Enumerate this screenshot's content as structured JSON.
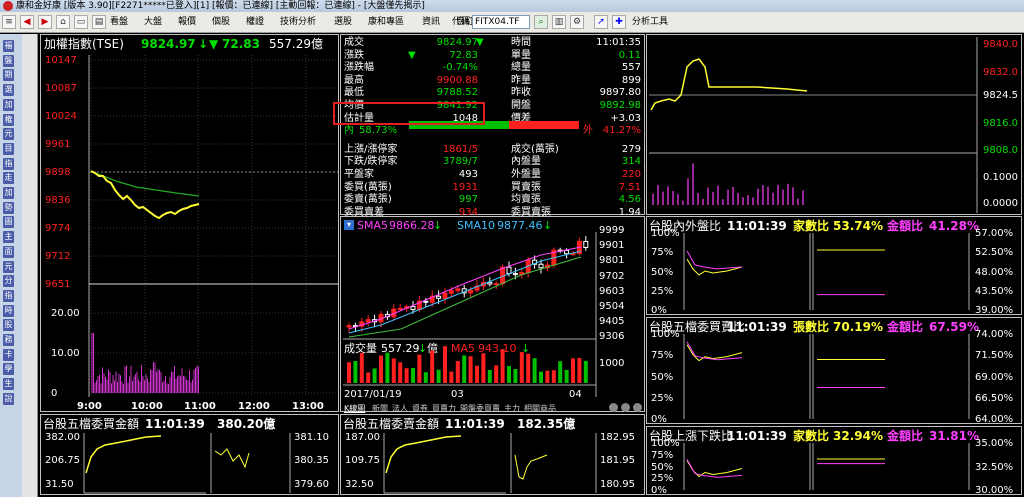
{
  "window": {
    "title": "康和金好康 [版本 3.90][F2271*****已登入][1] [報價：已連線] [主動回報：已連線] - [大盤僅先揭示]"
  },
  "toolbar": {
    "menus": [
      "看盤",
      "大盤",
      "報價",
      "個股",
      "權證",
      "技術分析",
      "選股",
      "康和專區",
      "資訊",
      "自訂",
      "功能"
    ],
    "code_label": "代碼",
    "code_value": "FITX04.TF",
    "analysis_tool": "分析工具"
  },
  "left_menu": [
    "福",
    "盤",
    "期",
    "選",
    "加",
    "権",
    "元",
    "目",
    "指",
    "走",
    "加",
    "勢",
    "圖",
    "主",
    "面",
    "元",
    "分",
    "指",
    "時",
    "股",
    "務",
    "卡",
    "學",
    "生",
    "說"
  ],
  "colors": {
    "up": "#ff2020",
    "down": "#00e000",
    "line_yellow": "#ffff33",
    "line_magenta": "#ff40ff",
    "background": "#000000"
  },
  "index_chart": {
    "title": "加權指數(TSE)",
    "price": "9824.97",
    "arrow": "▼",
    "change": "72.83",
    "volume": "557.29億",
    "y_ticks": [
      "10147",
      "10087",
      "10024",
      "9961",
      "9898",
      "9836",
      "9774",
      "9712",
      "9651"
    ],
    "vol_ticks": [
      "20.00",
      "10.00",
      "0"
    ],
    "x_ticks": [
      "9:00",
      "10:00",
      "11:00",
      "12:00",
      "13:00"
    ]
  },
  "quote": {
    "rows_left": [
      {
        "label": "成交",
        "value": "9824.97",
        "flag": "▼",
        "color": "down"
      },
      {
        "label": "漲跌",
        "value": "72.83",
        "flag": "▼",
        "color": "down"
      },
      {
        "label": "漲跌幅",
        "value": "-0.74%",
        "color": "down"
      },
      {
        "label": "最高",
        "value": "9900.88",
        "color": "up"
      },
      {
        "label": "最低",
        "value": "9788.52",
        "color": "down"
      },
      {
        "label": "均價",
        "value": "9841.92",
        "color": "down"
      },
      {
        "label": "估計量",
        "value": "1048",
        "color": "white"
      },
      {
        "label": "內",
        "value": "58.73%",
        "color": "down"
      },
      {
        "label": "上漲/漲停家",
        "value": "1861/5",
        "color": "up"
      },
      {
        "label": "下跌/跌停家",
        "value": "3789/7",
        "color": "down"
      },
      {
        "label": "平盤家",
        "value": "493",
        "color": "white"
      },
      {
        "label": "委買(萬張)",
        "value": "1931",
        "color": "up"
      },
      {
        "label": "委賣(萬張)",
        "value": "997",
        "color": "down"
      },
      {
        "label": "委買賣差",
        "value": "934",
        "color": "up"
      }
    ],
    "rows_right": [
      {
        "label": "時間",
        "value": "11:01:35",
        "color": "white"
      },
      {
        "label": "單量",
        "value": "0.11",
        "color": "down"
      },
      {
        "label": "總量",
        "value": "557",
        "color": "white"
      },
      {
        "label": "昨量",
        "value": "899",
        "color": "white"
      },
      {
        "label": "昨收",
        "value": "9897.80",
        "color": "white"
      },
      {
        "label": "開盤",
        "value": "9892.98",
        "color": "down"
      },
      {
        "label": "價差",
        "value": "+3.03",
        "color": "white"
      },
      {
        "label": "外",
        "value": "41.27%",
        "color": "up"
      },
      {
        "label": "成交(萬張)",
        "value": "279",
        "color": "white"
      },
      {
        "label": "內盤量",
        "value": "314",
        "color": "down"
      },
      {
        "label": "外盤量",
        "value": "220",
        "color": "up"
      },
      {
        "label": "買賣張",
        "value": "7.51",
        "color": "up"
      },
      {
        "label": "均賣張",
        "value": "4.56",
        "color": "down"
      },
      {
        "label": "委買賣張",
        "value": "1.94",
        "color": "white"
      }
    ],
    "inner_ratio": 0.5873
  },
  "kline": {
    "sma5_label": "SMA5",
    "sma5_value": "9866.28",
    "sma10_label": "SMA10",
    "sma10_value": "9877.46",
    "y_ticks": [
      "9999",
      "9901",
      "9801",
      "9702",
      "9603",
      "9504",
      "9405",
      "9306"
    ],
    "vol_label": "成交量",
    "vol_value": "557.29",
    "vol_unit": "億",
    "ma5_label": "MA5",
    "ma5_value": "943.10",
    "vol_ticks": [
      "1000"
    ],
    "x_ticks": [
      "2017/01/19",
      "03",
      "04"
    ],
    "tabs": [
      "K線圖",
      "新聞",
      "法人",
      "資券",
      "買賣力",
      "開盤委買賣",
      "主力",
      "相關商品"
    ]
  },
  "futures_chart": {
    "y_ticks": [
      "9840.0",
      "9832.0",
      "9824.5",
      "9816.0",
      "9808.0",
      "0.1000",
      "0.0000"
    ]
  },
  "ratio_panels": [
    {
      "title": "台股內外盤比",
      "time": "11:01:39",
      "k1": "家數比",
      "v1": "53.74%",
      "k2": "金額比",
      "v2": "41.28%",
      "left_ticks": [
        "100%",
        "75%",
        "50%",
        "25%",
        "0%"
      ],
      "right_ticks": [
        "57.00%",
        "52.50%",
        "48.00%",
        "43.50%",
        "39.00%"
      ]
    },
    {
      "title": "台股五檔委買賣比",
      "time": "11:01:39",
      "k1": "張數比",
      "v1": "70.19%",
      "k2": "金額比",
      "v2": "67.59%",
      "left_ticks": [
        "100%",
        "75%",
        "50%",
        "25%",
        "0%"
      ],
      "right_ticks": [
        "74.00%",
        "71.50%",
        "69.00%",
        "66.50%",
        "64.00%"
      ]
    },
    {
      "title": "台股上漲下跌比",
      "time": "11:01:39",
      "k1": "家數比",
      "v1": "32.94%",
      "k2": "金額比",
      "v2": "31.81%",
      "left_ticks": [
        "100%",
        "75%",
        "50%",
        "25%",
        "0%"
      ],
      "right_ticks": [
        "35.00%",
        "32.50%",
        "30.00%"
      ]
    }
  ],
  "bottom_panels": [
    {
      "title": "台股五檔委買金額",
      "time": "11:01:39",
      "value": "380.20億",
      "left_ticks": [
        "382.00",
        "206.75",
        "31.50"
      ],
      "right_ticks": [
        "381.10",
        "380.35",
        "379.60"
      ]
    },
    {
      "title": "台股五檔委賣金額",
      "time": "11:01:39",
      "value": "182.35億",
      "left_ticks": [
        "187.00",
        "109.75",
        "32.50"
      ],
      "right_ticks": [
        "182.95",
        "181.95",
        "180.95"
      ]
    }
  ]
}
